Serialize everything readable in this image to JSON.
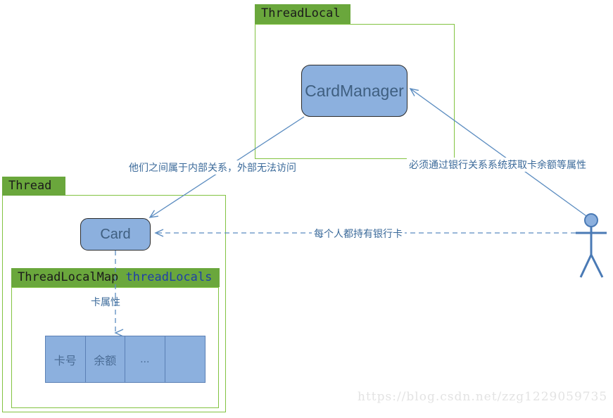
{
  "diagram": {
    "type": "uml-class-relationship-diagram",
    "colors": {
      "package_border": "#82c341",
      "package_tab": "#6aa73c",
      "node_fill": "#8cb0de",
      "node_border": "#2b2b2b",
      "connector": "#5b8cc0",
      "label_text": "#3b6a9a",
      "watermark": "#e3e3e3"
    },
    "packages": [
      {
        "id": "threadlocal",
        "tab_label": "ThreadLocal",
        "tab_accent": ""
      },
      {
        "id": "thread",
        "tab_label": "Thread",
        "tab_accent": ""
      },
      {
        "id": "threadlocalmap",
        "tab_label": "ThreadLocalMap",
        "tab_accent": "threadLocals"
      }
    ],
    "nodes": [
      {
        "id": "cardmanager",
        "label": "CardManager"
      },
      {
        "id": "card",
        "label": "Card"
      }
    ],
    "attribute_table": {
      "cells": [
        "卡号",
        "余额",
        "...",
        ""
      ]
    },
    "connector_labels": {
      "inner_relation": "他们之间属于内部关系，外部无法访问",
      "bank_system": "必须通过银行关系系统获取卡余额等属性",
      "holds_card": "每个人都持有银行卡",
      "card_attributes": "卡属性"
    },
    "actor": {
      "name": "actor-stick-figure"
    },
    "watermark": "https://blog.csdn.net/zzg1229059735"
  }
}
